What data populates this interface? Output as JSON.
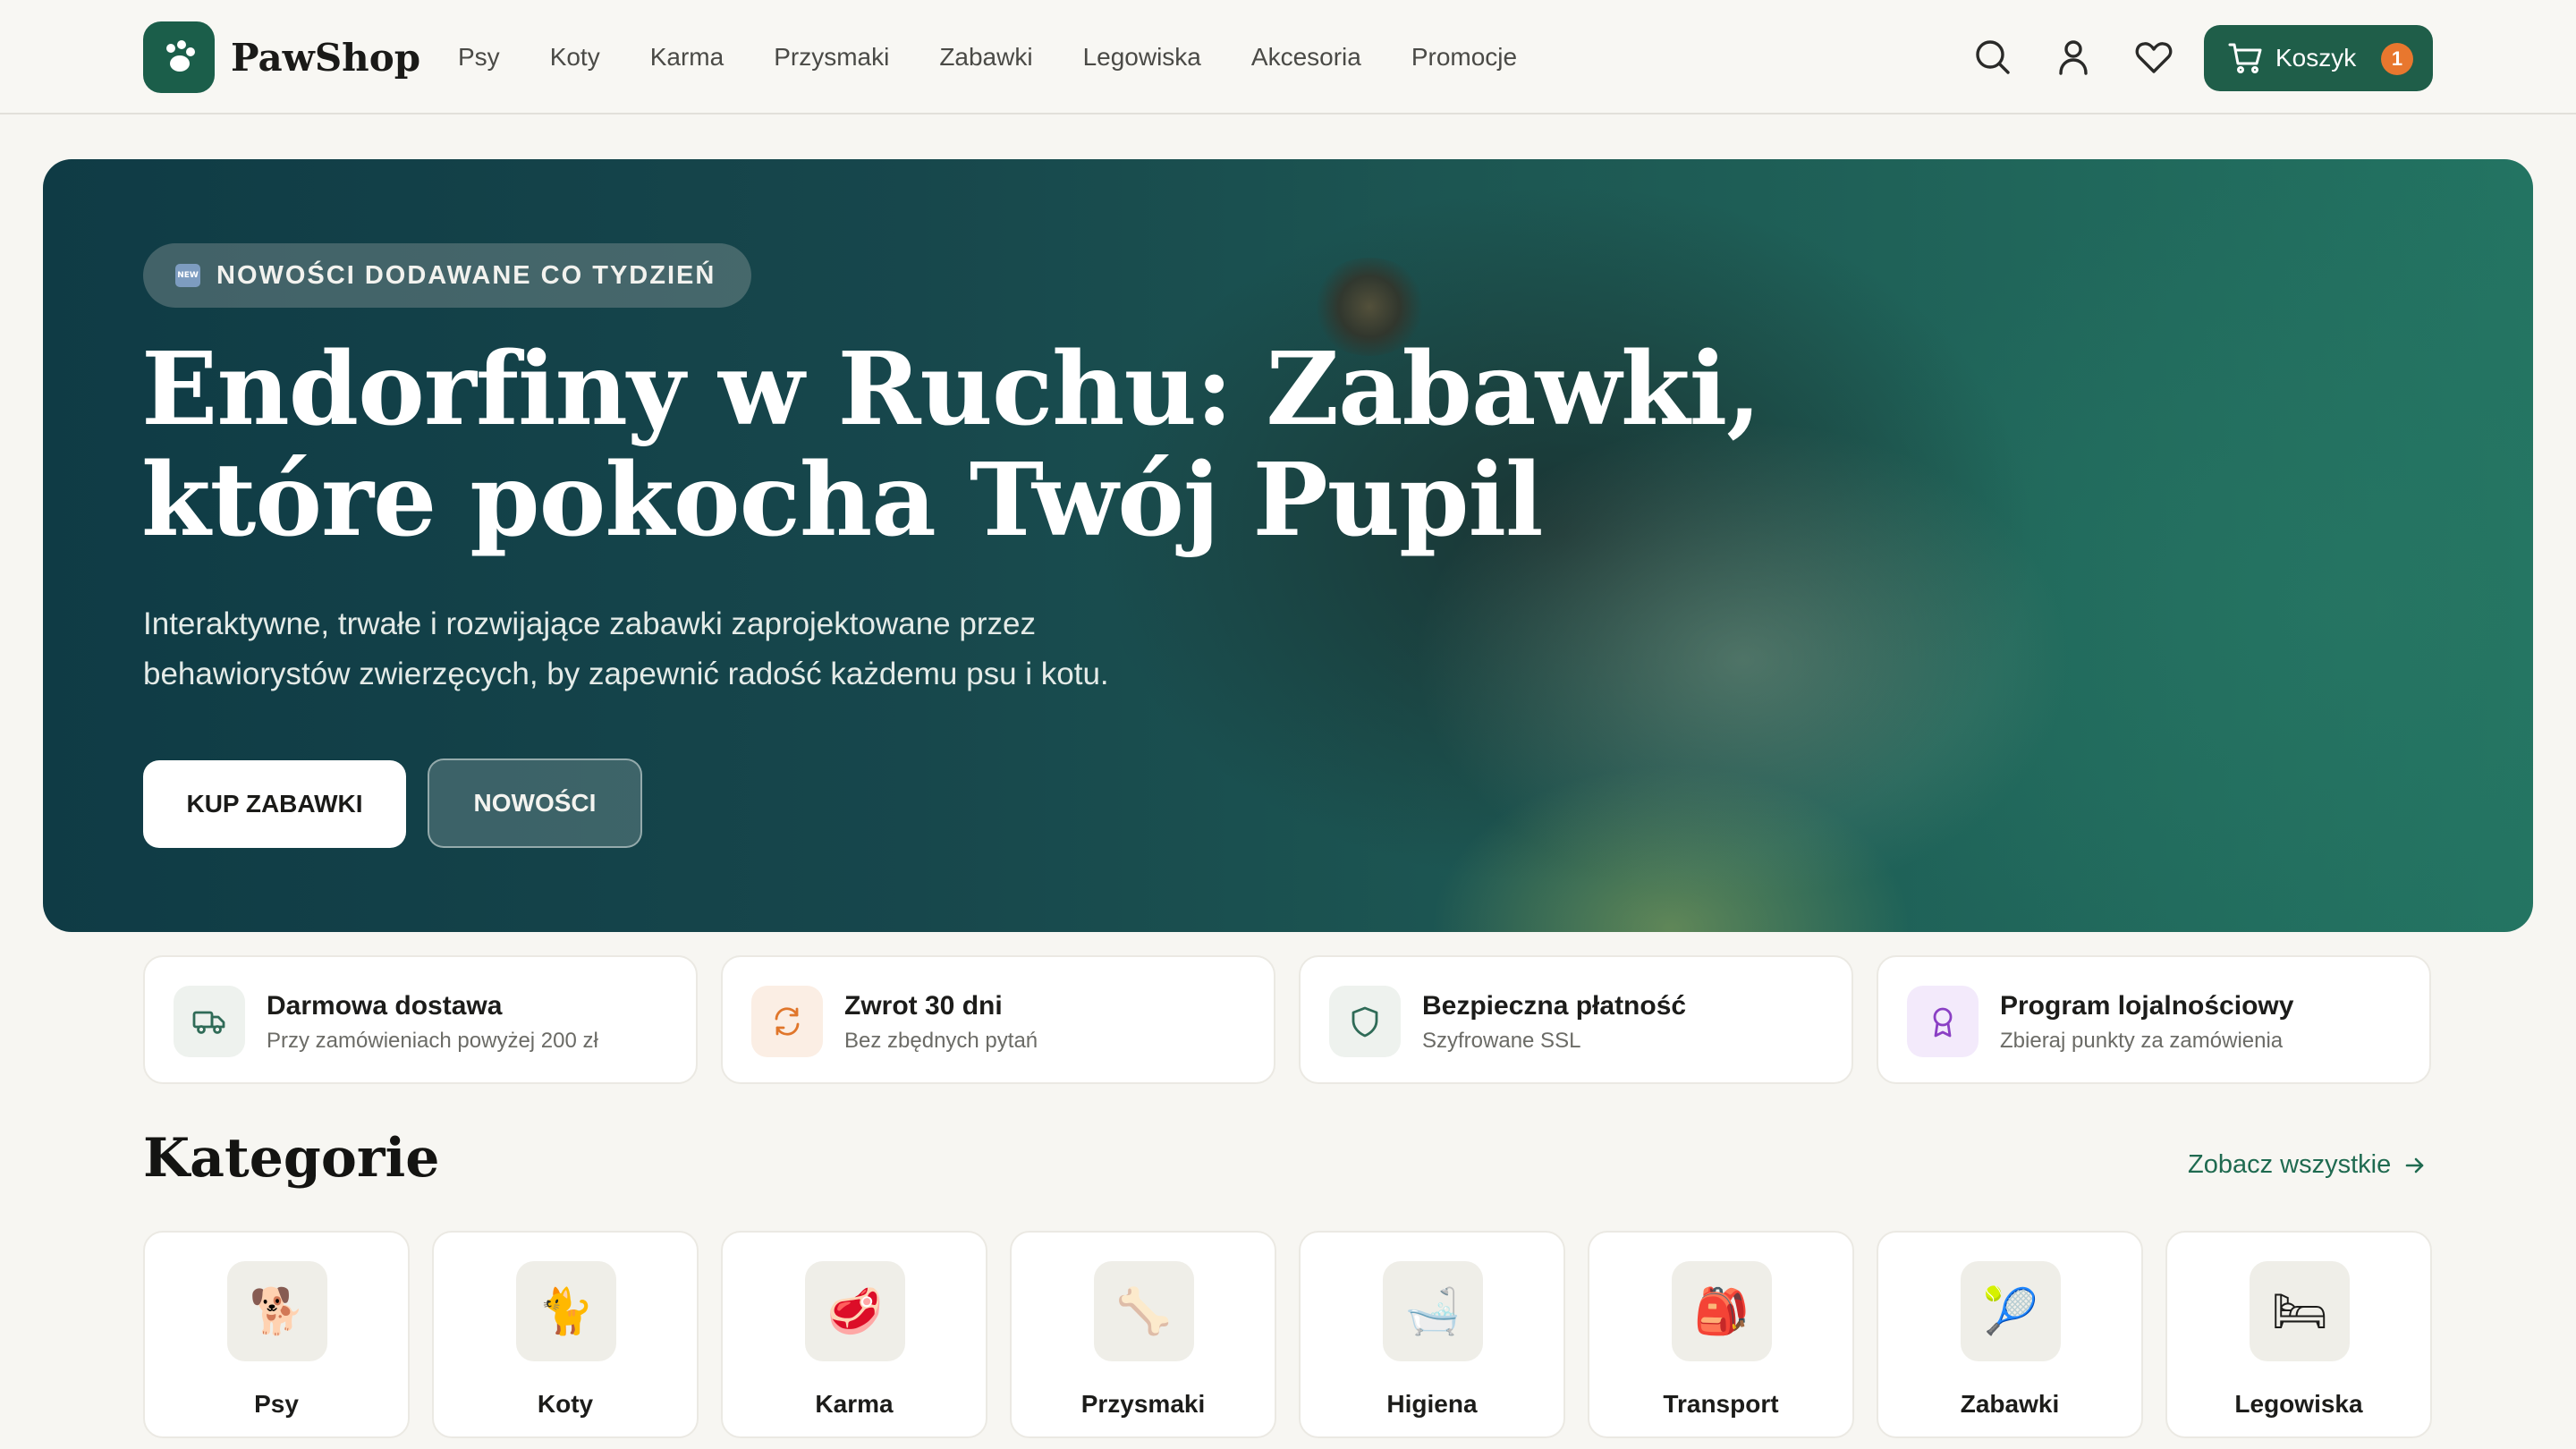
{
  "brand": {
    "name": "PawShop"
  },
  "nav": [
    "Psy",
    "Koty",
    "Karma",
    "Przysmaki",
    "Zabawki",
    "Legowiska",
    "Akcesoria",
    "Promocje"
  ],
  "header": {
    "icons": [
      "search-icon",
      "user-icon",
      "heart-icon"
    ],
    "cart": {
      "label": "Koszyk",
      "count": "1"
    }
  },
  "hero": {
    "badge": "NOWOŚCI DODAWANE CO TYDZIEŃ",
    "badge_icon_text": "NEW",
    "title_line1": "Endorfiny w Ruchu: Zabawki,",
    "title_line2": "które pokocha Twój Pupil",
    "subtitle_line1": "Interaktywne, trwałe i rozwijające zabawki zaprojektowane przez",
    "subtitle_line2": "behawiorystów zwierzęcych, by zapewnić radość każdemu psu i kotu.",
    "cta_primary": "KUP ZABAWKI",
    "cta_secondary": "NOWOŚCI"
  },
  "features": [
    {
      "title": "Darmowa dostawa",
      "desc": "Przy zamówieniach powyżej 200 zł",
      "icon": "truck-icon",
      "color": "#2f6b57"
    },
    {
      "title": "Zwrot 30 dni",
      "desc": "Bez zbędnych pytań",
      "icon": "refresh-icon",
      "color": "#e0762b"
    },
    {
      "title": "Bezpieczna płatność",
      "desc": "Szyfrowane SSL",
      "icon": "shield-icon",
      "color": "#2f6b57"
    },
    {
      "title": "Program lojalnościowy",
      "desc": "Zbieraj punkty za zamówienia",
      "icon": "award-icon",
      "color": "#8a3fc4"
    }
  ],
  "categories": {
    "title": "Kategorie",
    "see_all": "Zobacz wszystkie",
    "items": [
      {
        "label": "Psy",
        "emoji": "🐕"
      },
      {
        "label": "Koty",
        "emoji": "🐈"
      },
      {
        "label": "Karma",
        "emoji": "🥩"
      },
      {
        "label": "Przysmaki",
        "emoji": "🦴"
      },
      {
        "label": "Higiena",
        "emoji": "🛁"
      },
      {
        "label": "Transport",
        "emoji": "🎒"
      },
      {
        "label": "Zabawki",
        "emoji": "🎾"
      },
      {
        "label": "Legowiska",
        "emoji": "🛏"
      }
    ]
  },
  "colors": {
    "brand": "#1f5e49",
    "accent": "#e8772e",
    "background": "#f7f6f2"
  }
}
